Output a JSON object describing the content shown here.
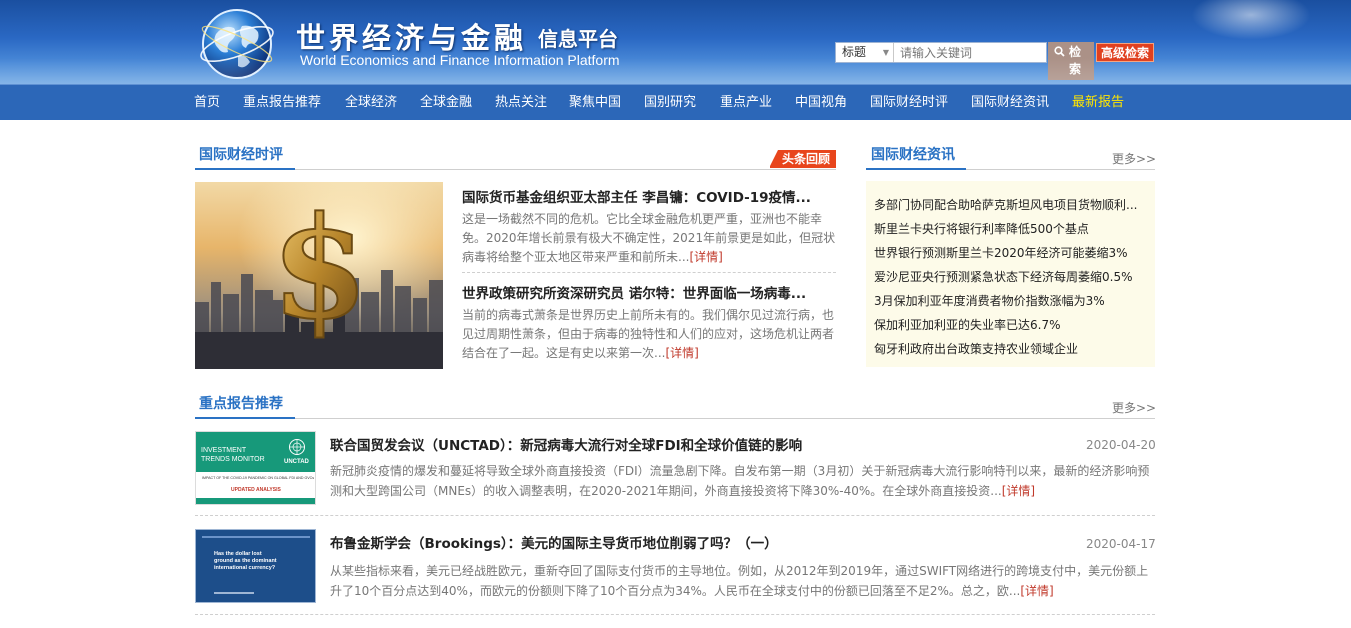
{
  "header": {
    "logo_cn": "世界经济与金融",
    "logo_sub": "信息平台",
    "logo_en": "World Economics and Finance Information Platform"
  },
  "search": {
    "field_selected": "标题",
    "placeholder": "请输入关键词",
    "button_label": "检索",
    "advanced_label": "高级检索"
  },
  "nav": {
    "items": [
      "首页",
      "重点报告推荐",
      "全球经济",
      "全球金融",
      "热点关注",
      "聚焦中国",
      "国别研究",
      "重点产业",
      "中国视角",
      "国际财经时评",
      "国际财经资讯",
      "最新报告"
    ],
    "active_color": "#ffe600"
  },
  "commentary": {
    "title": "国际财经时评",
    "badge": "头条回顾",
    "articles": [
      {
        "title": "国际货币基金组织亚太部主任 李昌镛：COVID-19疫情...",
        "body": "这是一场截然不同的危机。它比全球金融危机更严重，亚洲也不能幸免。2020年增长前景有极大不确定性，2021年前景更是如此，但冠状病毒将给整个亚太地区带来严重和前所未...",
        "detail": "[详情]"
      },
      {
        "title": "世界政策研究所资深研究员 诺尔特：世界面临一场病毒...",
        "body": "当前的病毒式萧条是世界历史上前所未有的。我们偶尔见过流行病，也见过周期性萧条，但由于病毒的独特性和人们的应对，这场危机让两者结合在了一起。这是有史以来第一次...",
        "detail": "[详情]"
      }
    ]
  },
  "news": {
    "title": "国际财经资讯",
    "more": "更多>>",
    "items": [
      "多部门协同配合助哈萨克斯坦风电项目货物顺利...",
      "斯里兰卡央行将银行利率降低500个基点",
      "世界银行预测斯里兰卡2020年经济可能萎缩3%",
      "爱沙尼亚央行预测紧急状态下经济每周萎缩0.5%",
      "3月保加利亚年度消费者物价指数涨幅为3%",
      "保加利亚加利亚的失业率已达6.7%",
      "匈牙利政府出台政策支持农业领域企业"
    ]
  },
  "reports": {
    "title": "重点报告推荐",
    "more": "更多>>",
    "items": [
      {
        "title": "联合国贸发会议（UNCTAD）：新冠病毒大流行对全球FDI和全球价值链的影响",
        "date": "2020-04-20",
        "body": "新冠肺炎疫情的爆发和蔓延将导致全球外商直接投资（FDI）流量急剧下降。自发布第一期（3月初）关于新冠病毒大流行影响特刊以来，最新的经济影响预测和大型跨国公司（MNEs）的收入调整表明，在2020-2021年期间，外商直接投资将下降30%-40%。在全球外商直接投资...",
        "detail": "[详情]",
        "thumb": {
          "line1": "INVESTMENT",
          "line2": "TRENDS MONITOR",
          "org": "UNCTAD",
          "caption": "IMPACT OF THE COVID-19 PANDEMIC ON GLOBAL FDI AND GVCs",
          "tag": "UPDATED ANALYSIS"
        }
      },
      {
        "title": "布鲁金斯学会（Brookings）：美元的国际主导货币地位削弱了吗？（一）",
        "date": "2020-04-17",
        "body": "从某些指标来看，美元已经战胜欧元，重新夺回了国际支付货币的主导地位。例如，从2012年到2019年，通过SWIFT网络进行的跨境支付中，美元份额上升了10个百分点达到40%，而欧元的份额则下降了10个百分点为34%。人民币在全球支付中的份额已回落至不足2%。总之，欧...",
        "detail": "[详情]",
        "thumb": {
          "text": "Has the dollar lost ground as the dominant international currency?"
        }
      }
    ]
  }
}
